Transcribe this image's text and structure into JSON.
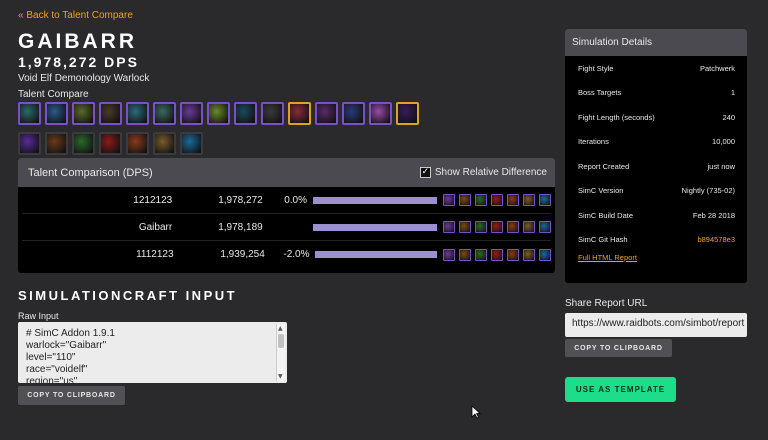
{
  "nav": {
    "back_link": "« Back to Talent Compare"
  },
  "character": {
    "name": "GAIBARR",
    "dps": "1,978,272 DPS",
    "spec": "Void Elf Demonology Warlock"
  },
  "talent_compare_label": "Talent Compare",
  "talent_icons_row1": [
    {
      "name": "talent-icon-1",
      "color": "#2a6a6a",
      "border": "purple"
    },
    {
      "name": "talent-icon-2",
      "color": "#2a5a8a",
      "border": "purple"
    },
    {
      "name": "talent-icon-3",
      "color": "#5a6a2a",
      "border": "purple"
    },
    {
      "name": "talent-icon-4",
      "color": "#4a3a2a",
      "border": "purple"
    },
    {
      "name": "talent-icon-5",
      "color": "#2a6a7a",
      "border": "purple"
    },
    {
      "name": "talent-icon-6",
      "color": "#3a6a5a",
      "border": "purple"
    },
    {
      "name": "talent-icon-7",
      "color": "#6a3a9a",
      "border": "purple"
    },
    {
      "name": "talent-icon-8",
      "color": "#6a8a2a",
      "border": "purple"
    },
    {
      "name": "talent-icon-9",
      "color": "#1a4a5a",
      "border": "purple"
    },
    {
      "name": "talent-icon-10",
      "color": "#3a3a3a",
      "border": "purple"
    },
    {
      "name": "talent-icon-11",
      "color": "#8a2a3a",
      "border": "gold"
    },
    {
      "name": "talent-icon-12",
      "color": "#5a2a6a",
      "border": "purple"
    },
    {
      "name": "talent-icon-13",
      "color": "#2a3a7a",
      "border": "purple"
    },
    {
      "name": "talent-icon-14",
      "color": "#9a4aaa",
      "border": "purple"
    },
    {
      "name": "talent-icon-15",
      "color": "#3a1a5a",
      "border": "gold"
    }
  ],
  "talent_icons_row2": [
    {
      "name": "talent-icon-16",
      "color": "#5a2a9a",
      "border": "plain"
    },
    {
      "name": "talent-icon-17",
      "color": "#6a3a1a",
      "border": "plain"
    },
    {
      "name": "talent-icon-18",
      "color": "#2a6a2a",
      "border": "plain"
    },
    {
      "name": "talent-icon-19",
      "color": "#8a1a1a",
      "border": "plain"
    },
    {
      "name": "talent-icon-20",
      "color": "#8a3a1a",
      "border": "plain"
    },
    {
      "name": "talent-icon-21",
      "color": "#7a5a2a",
      "border": "plain"
    },
    {
      "name": "talent-icon-22",
      "color": "#1a6a9a",
      "border": "plain"
    }
  ],
  "comparison": {
    "title": "Talent Comparison (DPS)",
    "show_relative_label": "Show Relative Difference",
    "show_relative_checked": "✓",
    "rows": [
      {
        "talents": "1212123",
        "dps": "1,978,272",
        "pct": "0.0%",
        "bar_fraction": 1.0
      },
      {
        "talents": "Gaibarr",
        "dps": "1,978,189",
        "pct": "",
        "bar_fraction": 1.0
      },
      {
        "talents": "1112123",
        "dps": "1,939,254",
        "pct": "-2.0%",
        "bar_fraction": 0.98
      }
    ],
    "mini_icon_colors": [
      "#6a3a9a",
      "#7a4a1a",
      "#2a6a2a",
      "#9a1a1a",
      "#8a3a1a",
      "#7a5a2a",
      "#1a6a9a"
    ]
  },
  "simc_input": {
    "section_title": "SIMULATIONCRAFT INPUT",
    "raw_label": "Raw Input",
    "lines": [
      "# SimC Addon 1.9.1",
      "warlock=\"Gaibarr\"",
      "level=\"110\"",
      "race=\"voidelf\"",
      "region=\"us\""
    ],
    "copy_label": "COPY TO CLIPBOARD"
  },
  "sim_details": {
    "title": "Simulation Details",
    "rows": [
      {
        "k": "Fight Style",
        "v": "Patchwerk"
      },
      {
        "k": "Boss Targets",
        "v": "1"
      },
      {
        "k": "Fight Length (seconds)",
        "v": "240"
      },
      {
        "k": "Iterations",
        "v": "10,000"
      },
      {
        "k": "Report Created",
        "v": "just now"
      },
      {
        "k": "SimC Version",
        "v": "Nightly (735-02)"
      },
      {
        "k": "SimC Build Date",
        "v": "Feb 28 2018"
      },
      {
        "k": "SimC Git Hash",
        "v": "b894578e3"
      }
    ],
    "full_report": "Full HTML Report"
  },
  "share": {
    "label": "Share Report URL",
    "url": "https://www.raidbots.com/simbot/report",
    "copy_label": "COPY TO CLIPBOARD"
  },
  "use_template_label": "USE AS TEMPLATE"
}
